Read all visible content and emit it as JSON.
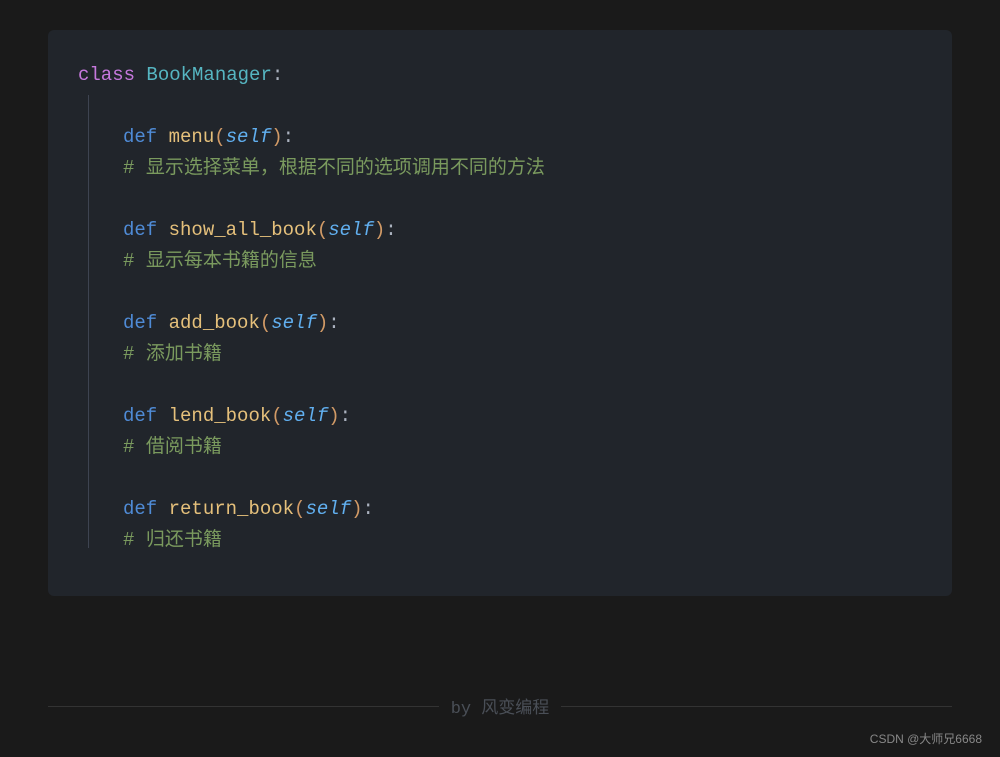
{
  "code": {
    "class_keyword": "class",
    "class_name": "BookManager",
    "def_keyword": "def",
    "self_keyword": "self",
    "methods": [
      {
        "name": "menu",
        "comment": "显示选择菜单，根据不同的选项调用不同的方法"
      },
      {
        "name": "show_all_book",
        "comment": "显示每本书籍的信息"
      },
      {
        "name": "add_book",
        "comment": "添加书籍"
      },
      {
        "name": "lend_book",
        "comment": "借阅书籍"
      },
      {
        "name": "return_book",
        "comment": "归还书籍"
      }
    ]
  },
  "footer": {
    "by_text": "by 风变编程"
  },
  "watermark": "CSDN @大师兄6668"
}
